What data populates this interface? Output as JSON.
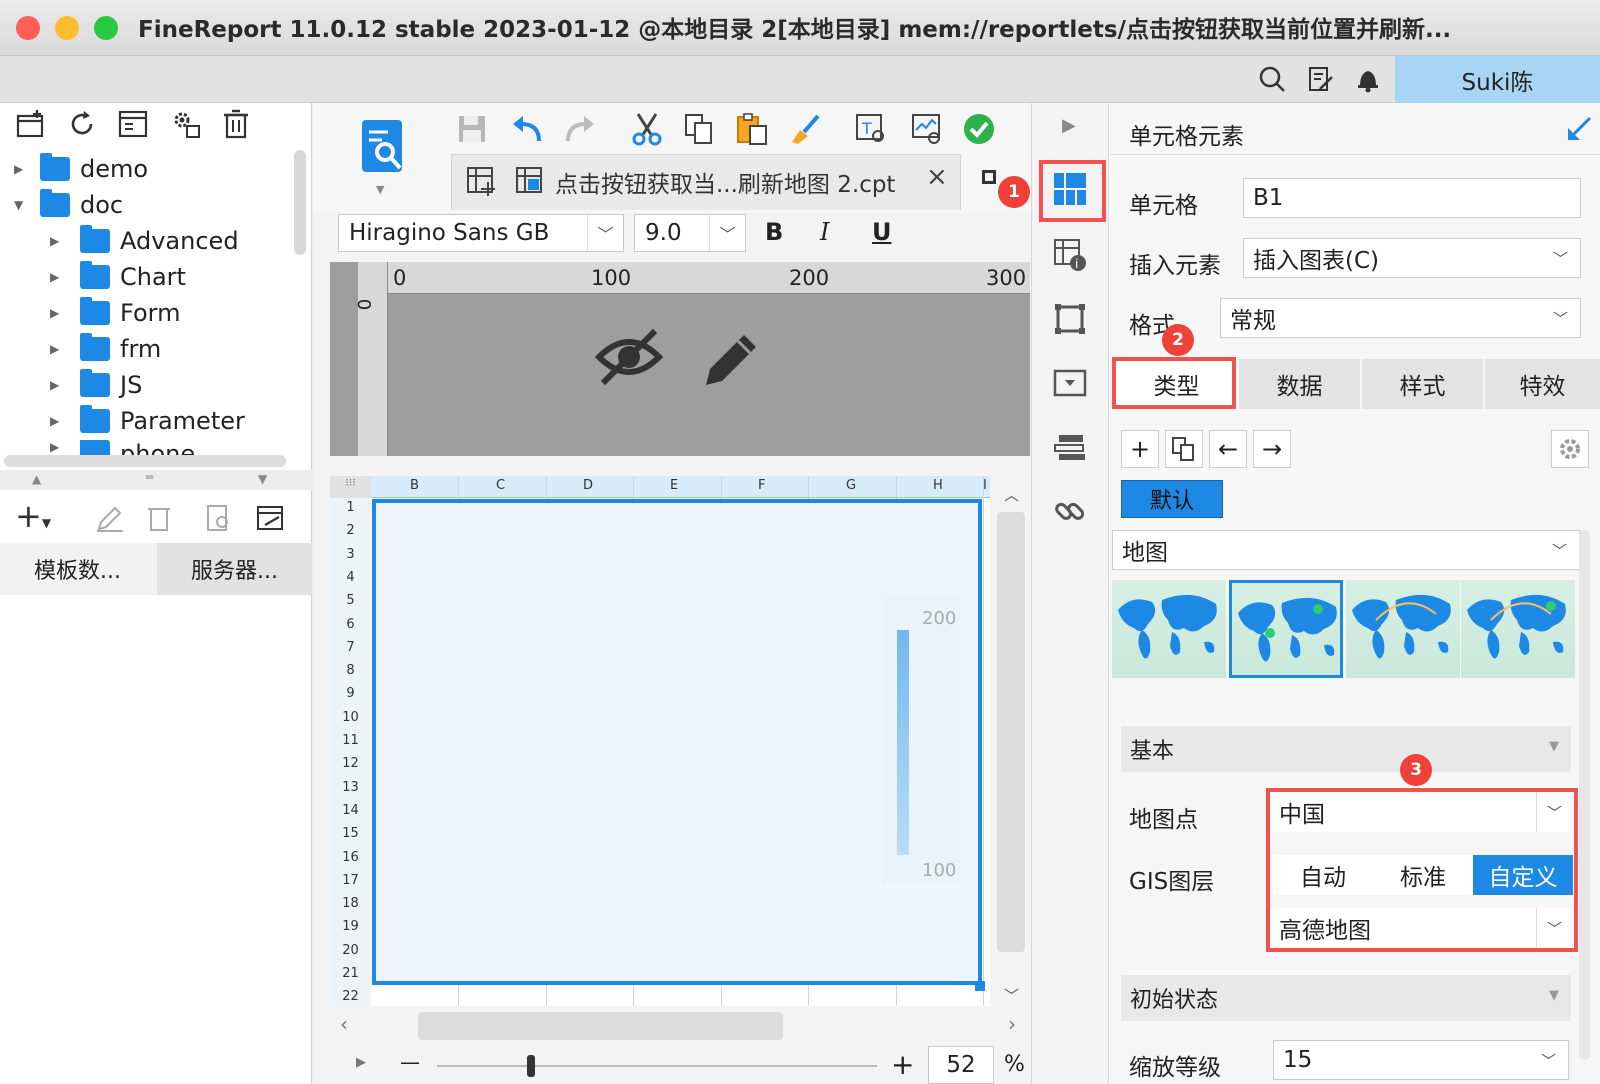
{
  "window": {
    "title": "FineReport 11.0.12 stable 2023-01-12 @本地目录 2[本地目录]   mem://reportlets/点击按钮获取当前位置并刷新..."
  },
  "userbar": {
    "user": "Suki陈"
  },
  "tree": [
    {
      "label": "demo",
      "level": 0,
      "expanded": false
    },
    {
      "label": "doc",
      "level": 0,
      "expanded": true
    },
    {
      "label": "Advanced",
      "level": 1
    },
    {
      "label": "Chart",
      "level": 1
    },
    {
      "label": "Form",
      "level": 1
    },
    {
      "label": "frm",
      "level": 1
    },
    {
      "label": "JS",
      "level": 1
    },
    {
      "label": "Parameter",
      "level": 1
    },
    {
      "label": "phone",
      "level": 1
    }
  ],
  "left_tabs": {
    "template": "模板数...",
    "server": "服务器..."
  },
  "editor": {
    "tab_title": "点击按钮获取当...刷新地图 2.cpt",
    "close": "×"
  },
  "fontbar": {
    "font": "Hiragino Sans GB",
    "size": "9.0",
    "bold": "B",
    "italic": "I",
    "underline": "U"
  },
  "ruler": [
    "0",
    "100",
    "200",
    "300"
  ],
  "ruler_v": "0",
  "grid": {
    "columns": [
      "B",
      "C",
      "D",
      "E",
      "F",
      "G",
      "H",
      "I"
    ],
    "rows": [
      "1",
      "2",
      "3",
      "4",
      "5",
      "6",
      "7",
      "8",
      "9",
      "10",
      "11",
      "12",
      "13",
      "14",
      "15",
      "16",
      "17",
      "18",
      "19",
      "20",
      "21",
      "22"
    ]
  },
  "gauge": {
    "max": "200",
    "min": "100"
  },
  "zoom": {
    "minus": "—",
    "plus": "+",
    "value": "52",
    "unit": "%"
  },
  "panel": {
    "title": "单元格元素",
    "cell_label": "单元格",
    "cell_value": "B1",
    "insert_label": "插入元素",
    "insert_value": "插入图表(C)",
    "format_label": "格式",
    "format_value": "常规",
    "tabs": [
      "类型",
      "数据",
      "样式",
      "特效"
    ],
    "default_badge": "默认",
    "chart_type": "地图",
    "basic": "基本",
    "map_point_label": "地图点",
    "map_point_value": "中国",
    "gis_label": "GIS图层",
    "gis_options": [
      "自动",
      "标准",
      "自定义"
    ],
    "gis_selected": "自定义",
    "gis_map": "高德地图",
    "init_state": "初始状态",
    "zoom_label": "缩放等级",
    "zoom_value": "15"
  },
  "badges": [
    "1",
    "2",
    "3"
  ],
  "colors": {
    "accent": "#1e88e5",
    "highlight_red": "#ef5350",
    "user_bg": "#a9d5f5",
    "selected_tab": "#1e88e5"
  }
}
